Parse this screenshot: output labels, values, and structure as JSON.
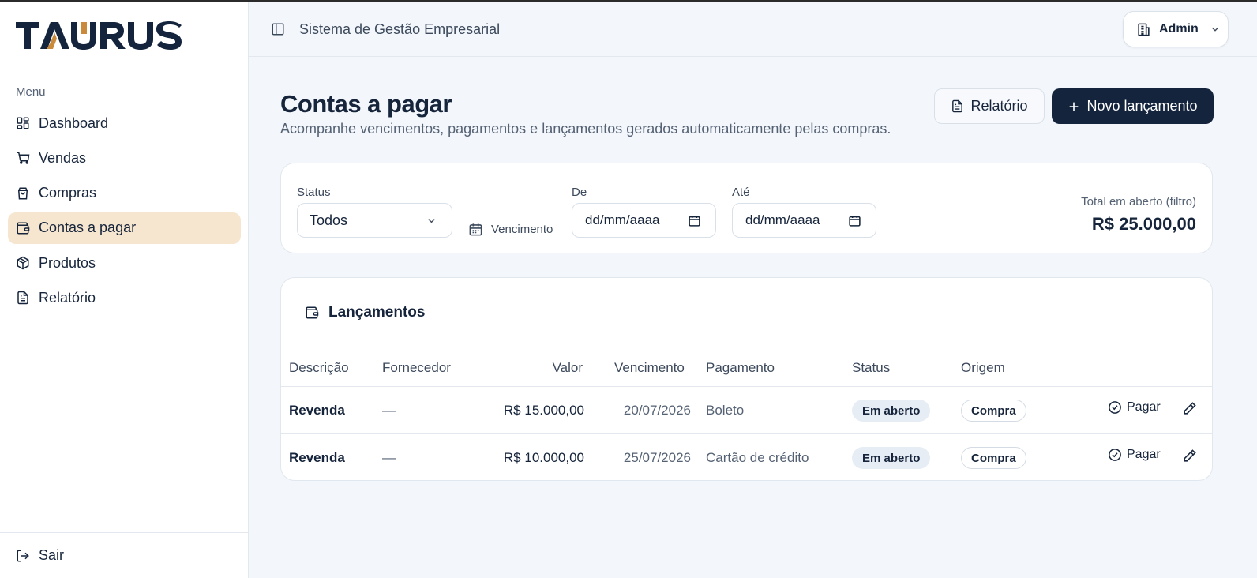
{
  "brand": {
    "logo_text": "TAURUS",
    "accent_color": "#c98a3c",
    "primary_color": "#14243d"
  },
  "sidebar": {
    "menu_title": "Menu",
    "items": [
      {
        "label": "Dashboard",
        "icon": "dashboard-icon",
        "active": false
      },
      {
        "label": "Vendas",
        "icon": "cart-icon",
        "active": false
      },
      {
        "label": "Compras",
        "icon": "shopping-bag-icon",
        "active": false
      },
      {
        "label": "Contas a pagar",
        "icon": "wallet-icon",
        "active": true
      },
      {
        "label": "Produtos",
        "icon": "package-icon",
        "active": false
      },
      {
        "label": "Relatório",
        "icon": "file-text-icon",
        "active": false
      }
    ],
    "logout_label": "Sair"
  },
  "topbar": {
    "title": "Sistema de Gestão Empresarial",
    "admin_label": "Admin"
  },
  "header": {
    "title": "Contas a pagar",
    "subtitle": "Acompanhe vencimentos, pagamentos e lançamentos gerados automaticamente pelas compras.",
    "report_button": "Relatório",
    "new_button": "Novo lançamento"
  },
  "filters": {
    "status_label": "Status",
    "status_value": "Todos",
    "due_label": "Vencimento",
    "from_label": "De",
    "from_value": "dd/mm/aaaa",
    "to_label": "Até",
    "to_value": "dd/mm/aaaa",
    "total_label": "Total em aberto (filtro)",
    "total_value": "R$ 25.000,00"
  },
  "table": {
    "title": "Lançamentos",
    "columns": [
      "Descrição",
      "Fornecedor",
      "Valor",
      "Vencimento",
      "Pagamento",
      "Status",
      "Origem"
    ],
    "rows": [
      {
        "descricao": "Revenda",
        "fornecedor": "—",
        "valor": "R$ 15.000,00",
        "vencimento": "20/07/2026",
        "pagamento": "Boleto",
        "status": "Em aberto",
        "origem": "Compra",
        "action": "Pagar"
      },
      {
        "descricao": "Revenda",
        "fornecedor": "—",
        "valor": "R$ 10.000,00",
        "vencimento": "25/07/2026",
        "pagamento": "Cartão de crédito",
        "status": "Em aberto",
        "origem": "Compra",
        "action": "Pagar"
      }
    ]
  }
}
